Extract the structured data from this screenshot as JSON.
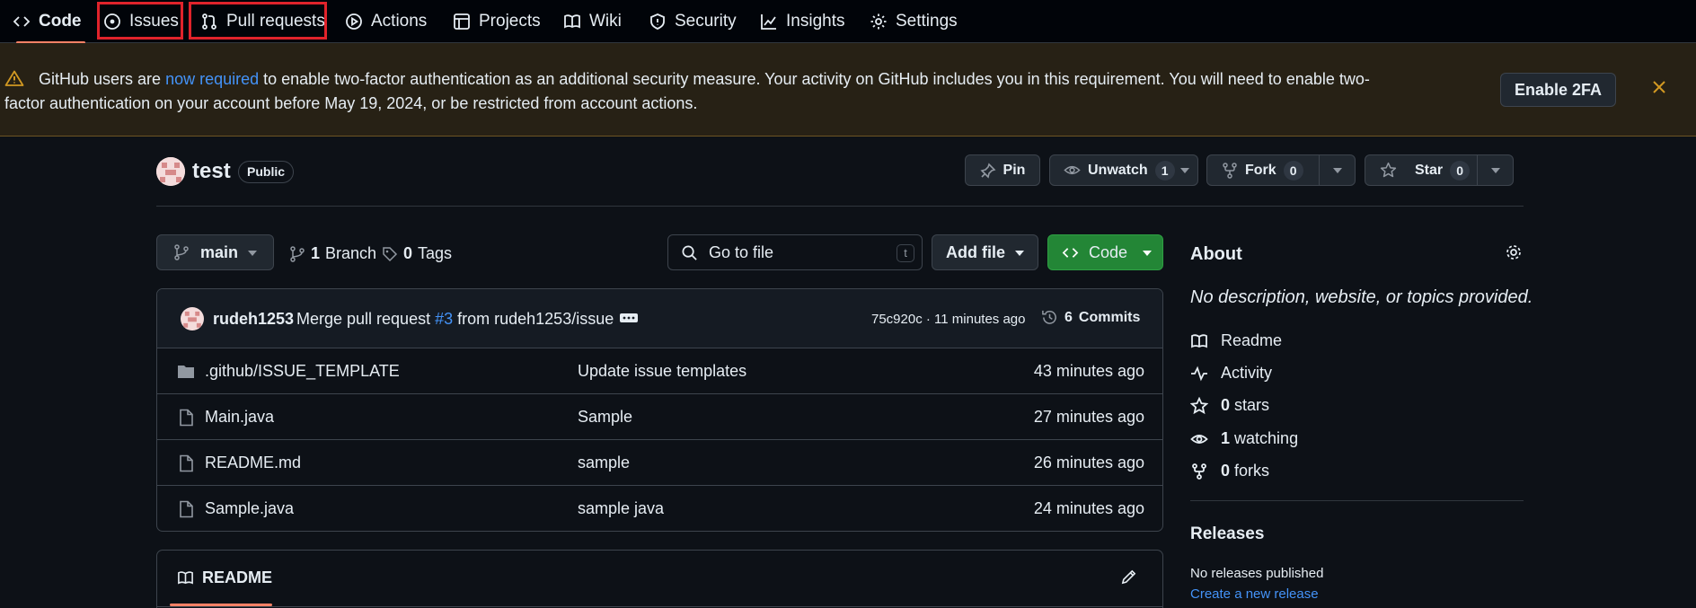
{
  "nav": {
    "tabs": [
      {
        "label": "Code",
        "icon": "code-icon",
        "active": true
      },
      {
        "label": "Issues",
        "icon": "issue-opened-icon"
      },
      {
        "label": "Pull requests",
        "icon": "git-pull-request-icon"
      },
      {
        "label": "Actions",
        "icon": "play-icon"
      },
      {
        "label": "Projects",
        "icon": "table-icon"
      },
      {
        "label": "Wiki",
        "icon": "book-icon"
      },
      {
        "label": "Security",
        "icon": "shield-icon"
      },
      {
        "label": "Insights",
        "icon": "graph-icon"
      },
      {
        "label": "Settings",
        "icon": "gear-icon"
      }
    ],
    "highlight_color": "#e0232b"
  },
  "banner": {
    "text_before": "GitHub users are ",
    "link": "now required",
    "text_after": " to enable two-factor authentication as an additional security measure. Your activity on GitHub includes you in this requirement. You will need to enable two-factor authentication on your account before May 19, 2024, or be restricted from account actions.",
    "button": "Enable 2FA"
  },
  "repo": {
    "name": "test",
    "visibility": "Public",
    "pin": "Pin",
    "unwatch": "Unwatch",
    "watch_count": "1",
    "fork": "Fork",
    "fork_count": "0",
    "star": "Star",
    "star_count": "0"
  },
  "branchbar": {
    "branch": "main",
    "branches_count": "1",
    "branches_label": "Branch",
    "tags_count": "0",
    "tags_label": "Tags",
    "search_placeholder": "Go to file",
    "search_key": "t",
    "add_file": "Add file",
    "code": "Code"
  },
  "commit": {
    "author": "rudeh1253",
    "message_before": "Merge pull request ",
    "pr": "#3",
    "message_after": " from rudeh1253/issue",
    "meta": "75c920c · 11 minutes ago",
    "commits_count": "6",
    "commits_label": "Commits"
  },
  "files": [
    {
      "name": ".github/ISSUE_TEMPLATE",
      "type": "folder",
      "message": "Update issue templates",
      "time": "43 minutes ago"
    },
    {
      "name": "Main.java",
      "type": "file",
      "message": "Sample",
      "time": "27 minutes ago"
    },
    {
      "name": "README.md",
      "type": "file",
      "message": "sample",
      "time": "26 minutes ago"
    },
    {
      "name": "Sample.java",
      "type": "file",
      "message": "sample java",
      "time": "24 minutes ago"
    }
  ],
  "readme": {
    "tab": "README"
  },
  "about": {
    "title": "About",
    "description": "No description, website, or topics provided.",
    "readme": "Readme",
    "activity": "Activity",
    "stars_count": "0",
    "stars_label": "stars",
    "watching_count": "1",
    "watching_label": "watching",
    "forks_count": "0",
    "forks_label": "forks"
  },
  "releases": {
    "title": "Releases",
    "none": "No releases published",
    "create": "Create a new release"
  },
  "colors": {
    "accent_underline": "#f78166",
    "green_button": "#238636",
    "link": "#4493f8",
    "banner_bg": "#272115"
  }
}
